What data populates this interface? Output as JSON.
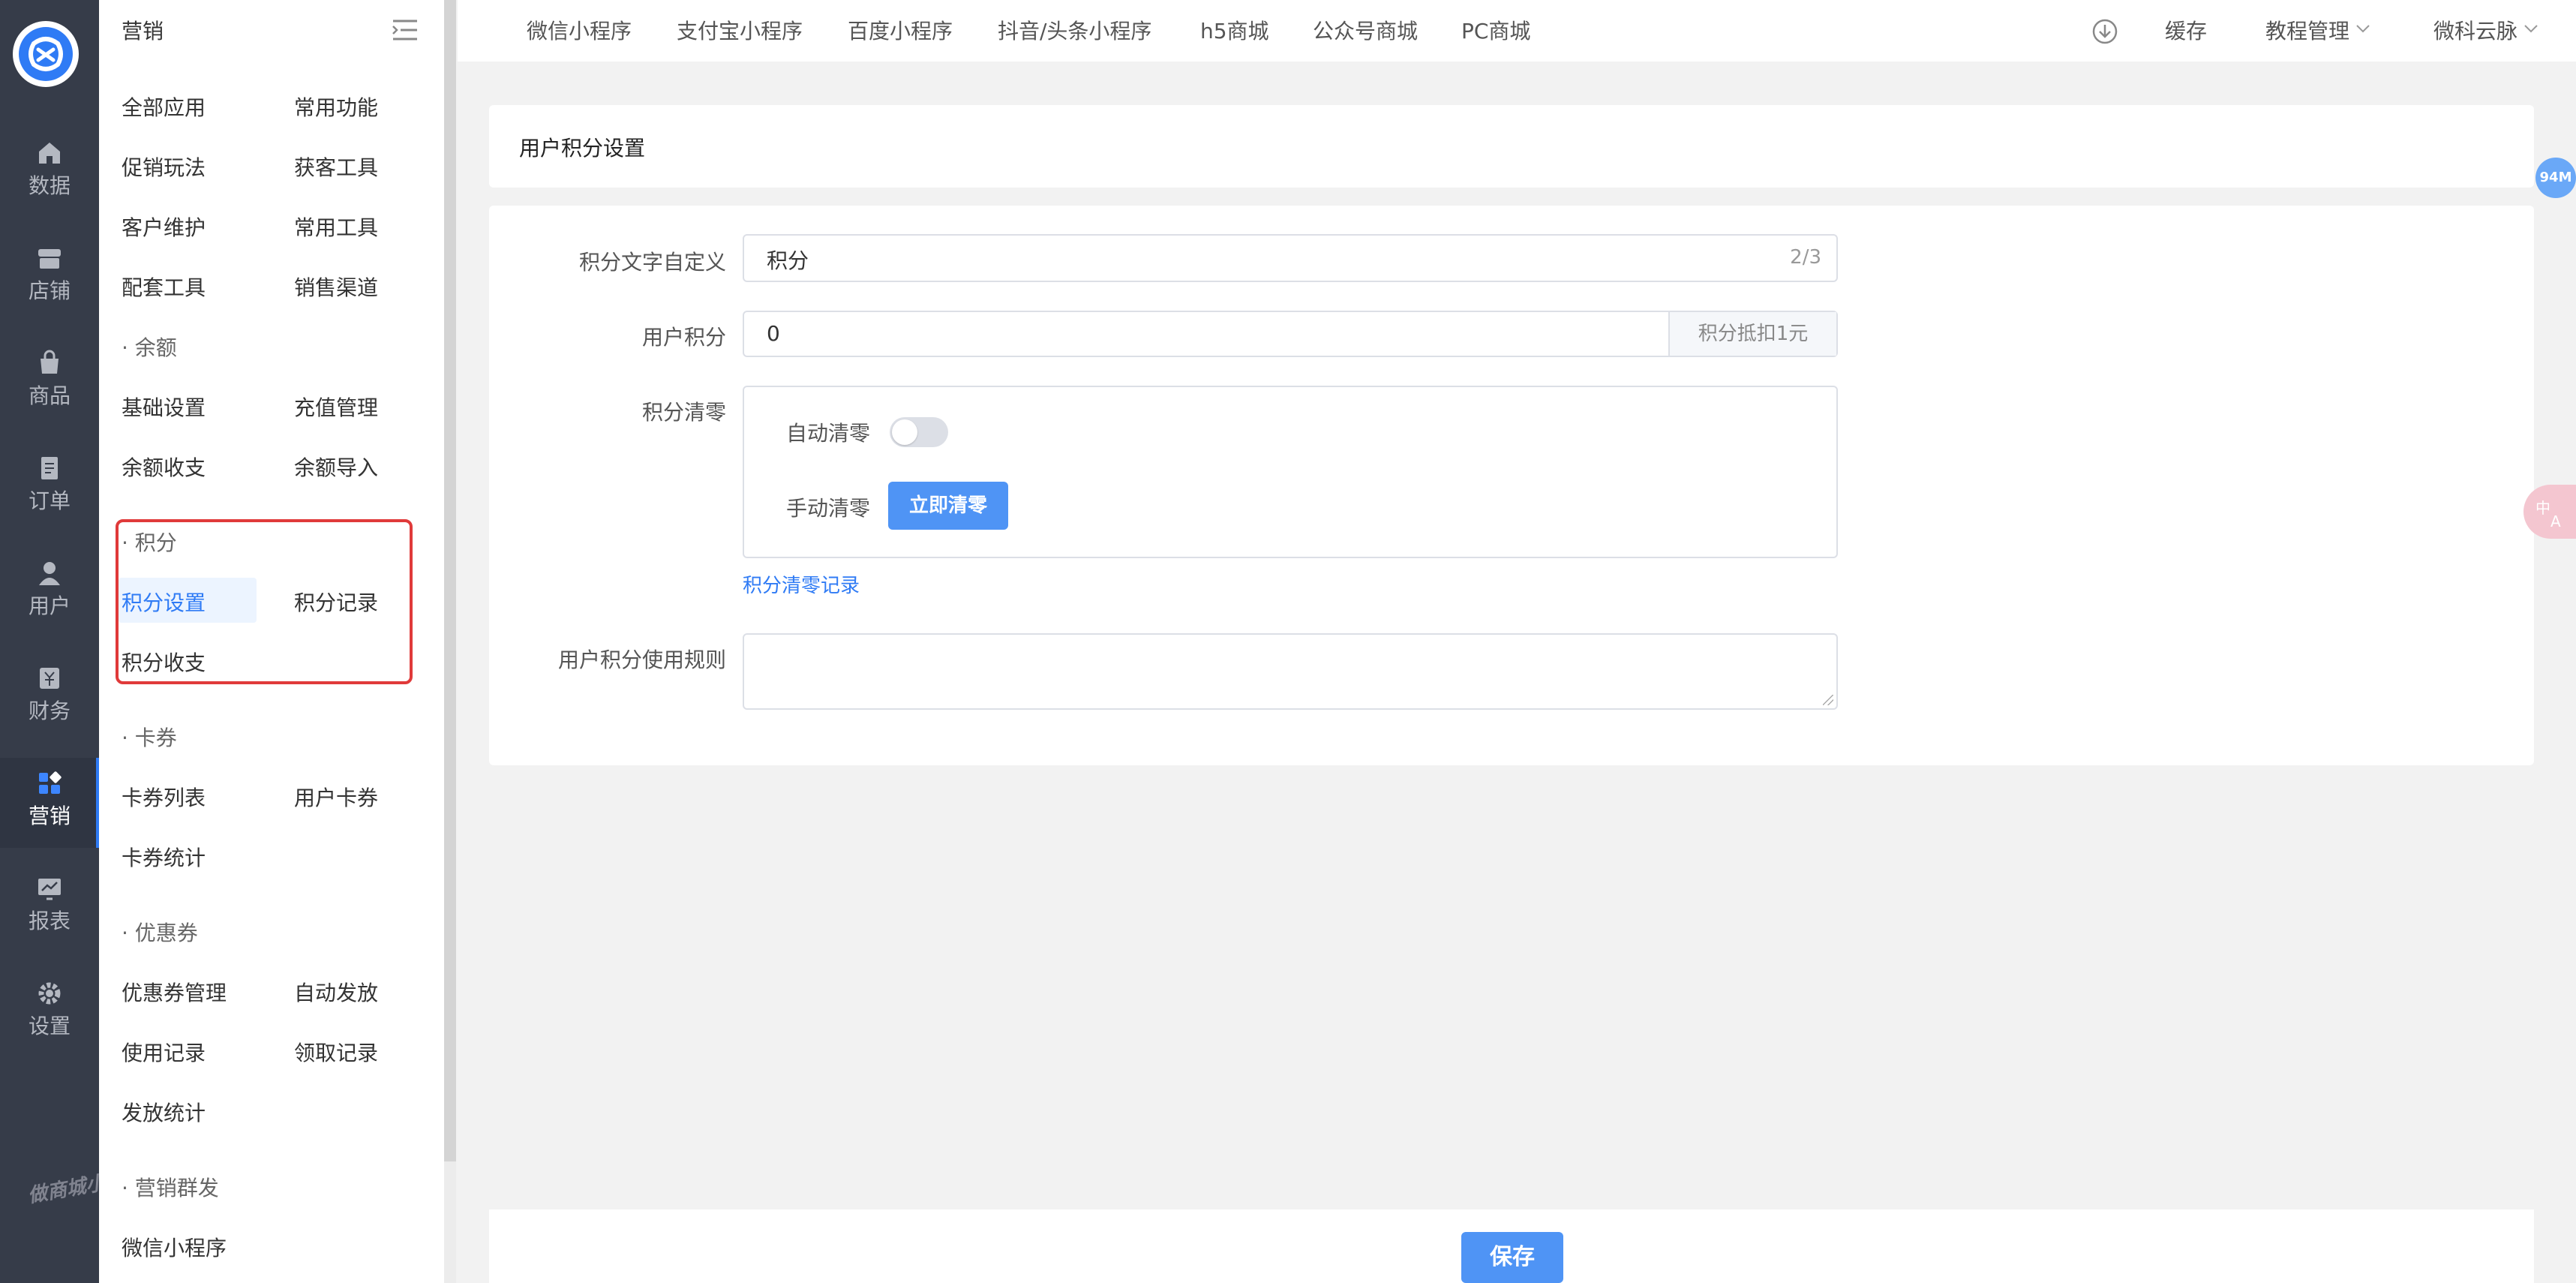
{
  "rail": {
    "items": [
      {
        "label": "数据",
        "icon": "home-icon"
      },
      {
        "label": "店铺",
        "icon": "store-icon"
      },
      {
        "label": "商品",
        "icon": "bag-icon"
      },
      {
        "label": "订单",
        "icon": "order-icon"
      },
      {
        "label": "用户",
        "icon": "user-icon"
      },
      {
        "label": "财务",
        "icon": "finance-icon"
      },
      {
        "label": "营销",
        "icon": "grid-icon"
      },
      {
        "label": "报表",
        "icon": "chart-icon"
      },
      {
        "label": "设置",
        "icon": "gear-icon"
      }
    ],
    "active": "营销",
    "watermark": "做商城小程序 百度搜微科云脉"
  },
  "submenu": {
    "title": "营销",
    "row1": [
      "全部应用",
      "常用功能"
    ],
    "row2": [
      "促销玩法",
      "获客工具"
    ],
    "row3": [
      "客户维护",
      "常用工具"
    ],
    "row4": [
      "配套工具",
      "销售渠道"
    ],
    "group_balance": "· 余额",
    "balance1": [
      "基础设置",
      "充值管理"
    ],
    "balance2": [
      "余额收支",
      "余额导入"
    ],
    "group_points": "· 积分",
    "points1": [
      "积分设置",
      "积分记录"
    ],
    "points2": [
      "积分收支"
    ],
    "group_card": "· 卡券",
    "card1": [
      "卡券列表",
      "用户卡券"
    ],
    "card2": [
      "卡券统计"
    ],
    "group_coupon": "· 优惠券",
    "coupon1": [
      "优惠券管理",
      "自动发放"
    ],
    "coupon2": [
      "使用记录",
      "领取记录"
    ],
    "coupon3": [
      "发放统计"
    ],
    "group_mass": "· 营销群发",
    "mass1": [
      "微信小程序"
    ]
  },
  "topbar": {
    "tabs": [
      "微信小程序",
      "支付宝小程序",
      "百度小程序",
      "抖音/头条小程序",
      "h5商城",
      "公众号商城",
      "PC商城"
    ],
    "cache": "缓存",
    "tutorial": "教程管理",
    "account": "微科云脉"
  },
  "page": {
    "title": "用户积分设置",
    "points_text_label": "积分文字自定义",
    "points_text_value": "积分",
    "points_text_count": "2/3",
    "user_points_label": "用户积分",
    "user_points_value": "0",
    "user_points_append": "积分抵扣1元",
    "clear_label": "积分清零",
    "auto_clear_label": "自动清零",
    "auto_clear_on": false,
    "manual_clear_label": "手动清零",
    "clear_now_button": "立即清零",
    "clear_record_link": "积分清零记录",
    "rules_label": "用户积分使用规则",
    "rules_value": "",
    "save_button": "保存"
  },
  "widgets": {
    "memory_badge": "94M",
    "translate_icon": "translate-icon"
  },
  "colors": {
    "rail_bg": "#363c49",
    "primary": "#2f7bf5",
    "button": "#4f94f5",
    "highlight_box": "#e03a3a"
  }
}
